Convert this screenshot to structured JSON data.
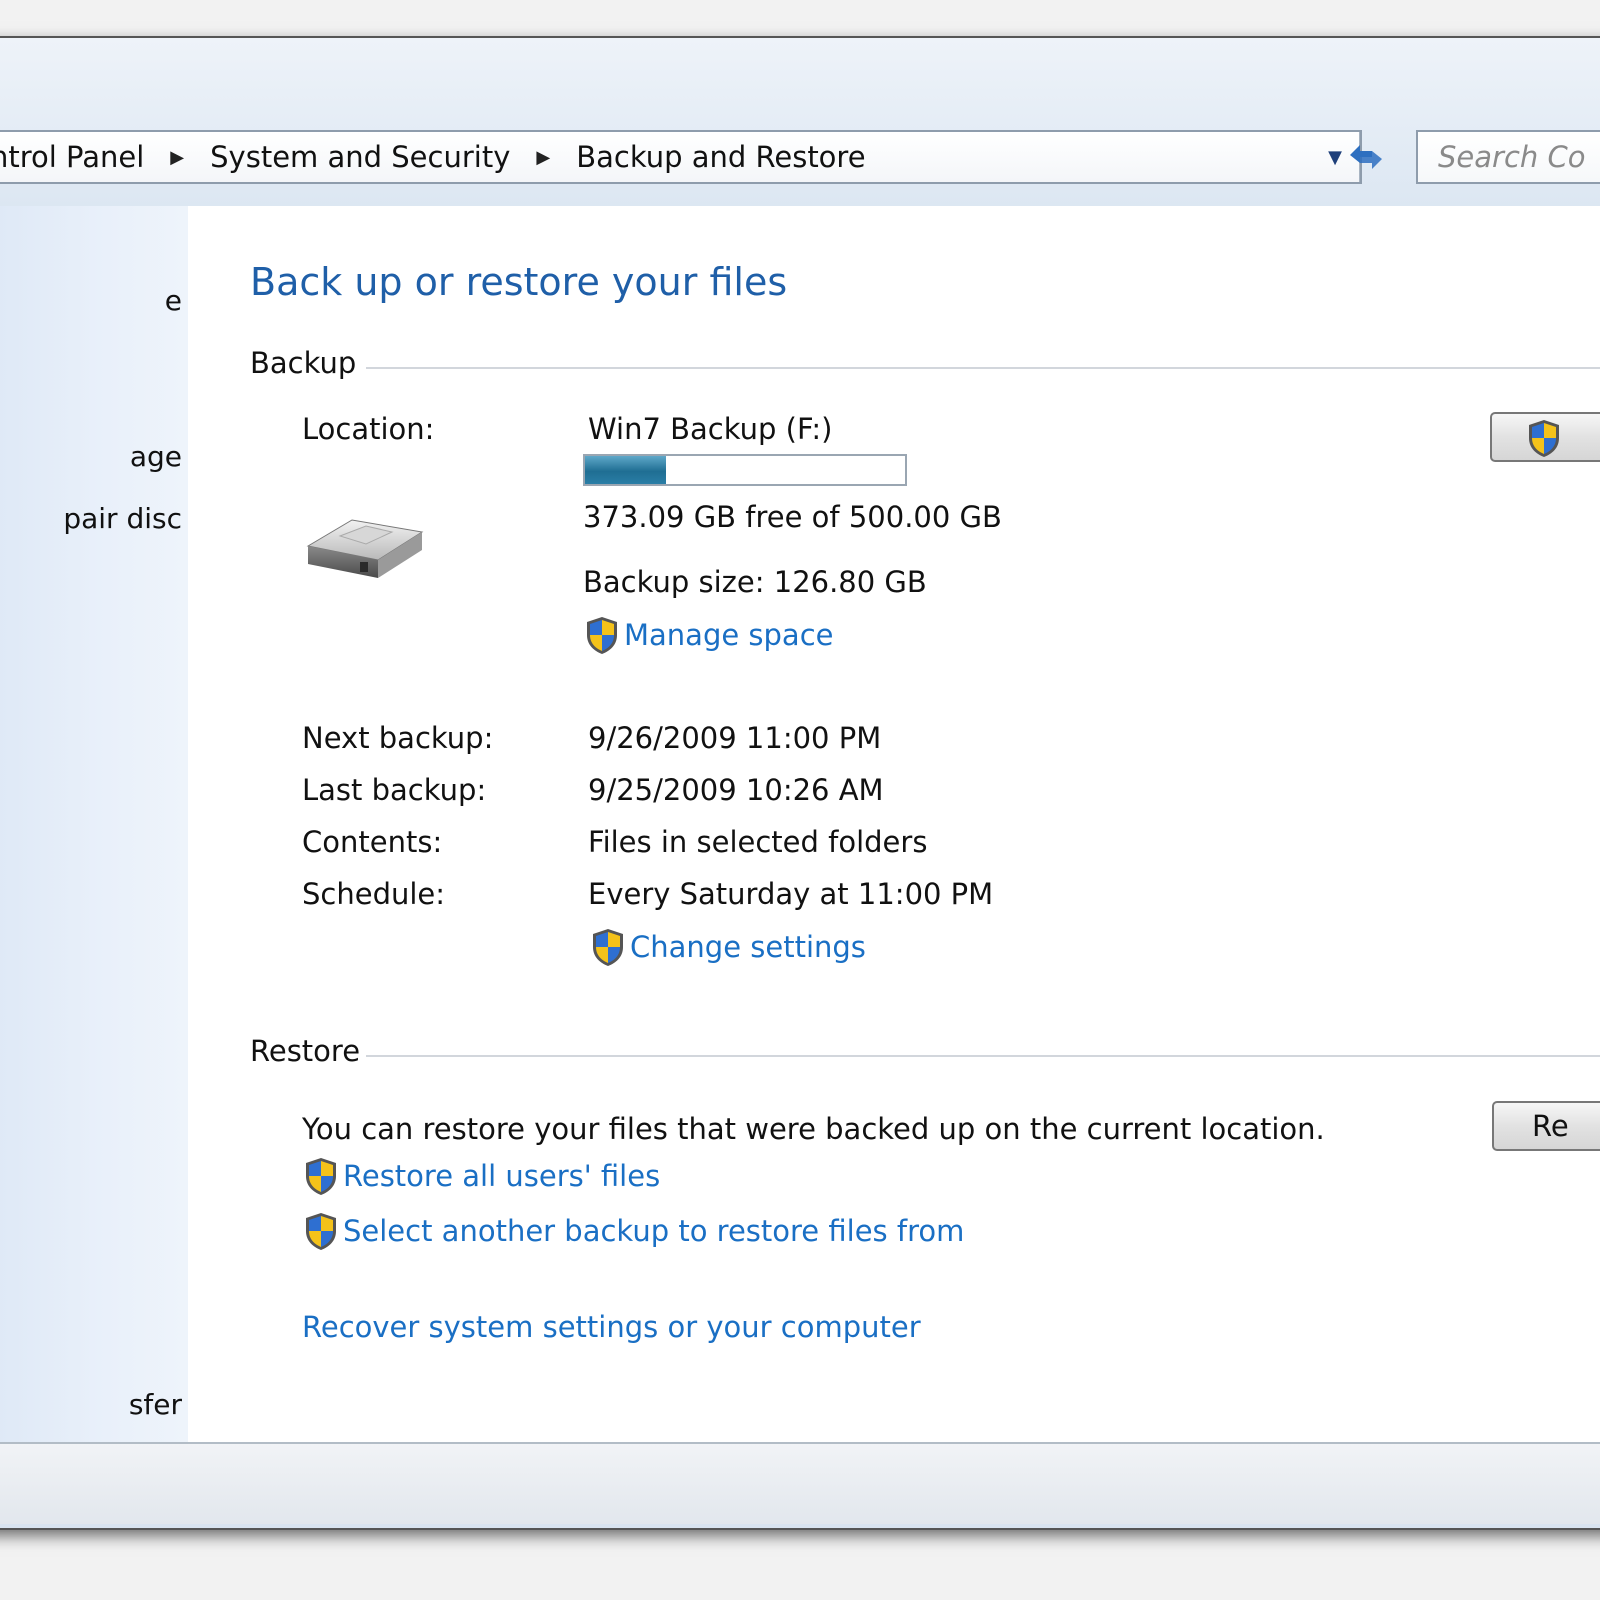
{
  "address": {
    "breadcrumbs": [
      "ntrol Panel",
      "System and Security",
      "Backup and Restore"
    ],
    "search_placeholder": "Search Co"
  },
  "sidebar": {
    "items": [
      {
        "label": "e"
      },
      {
        "label": "age"
      },
      {
        "label": "pair disc"
      },
      {
        "label": "sfer"
      }
    ]
  },
  "main": {
    "title": "Back up or restore your files",
    "backup": {
      "heading": "Backup",
      "location_label": "Location:",
      "location_value": "Win7 Backup (F:)",
      "used_fraction": 0.2536,
      "free_text": "373.09 GB free of 500.00 GB",
      "backup_size": "Backup size: 126.80 GB",
      "manage_space": "Manage space",
      "next_label": "Next backup:",
      "next_value": "9/26/2009 11:00 PM",
      "last_label": "Last backup:",
      "last_value": "9/25/2009 10:26 AM",
      "contents_label": "Contents:",
      "contents_value": "Files in selected folders",
      "schedule_label": "Schedule:",
      "schedule_value": "Every Saturday at 11:00 PM",
      "change_settings": "Change settings",
      "backup_button": ""
    },
    "restore": {
      "heading": "Restore",
      "description": "You can restore your files that were backed up on the current location.",
      "restore_all": "Restore all users' files",
      "select_another": "Select another backup to restore files from",
      "recover": "Recover system settings or your computer",
      "restore_button": "Re"
    }
  },
  "colors": {
    "link": "#1a6fc4",
    "title": "#1f5fa8",
    "progress_fill": "#1f6e93"
  }
}
